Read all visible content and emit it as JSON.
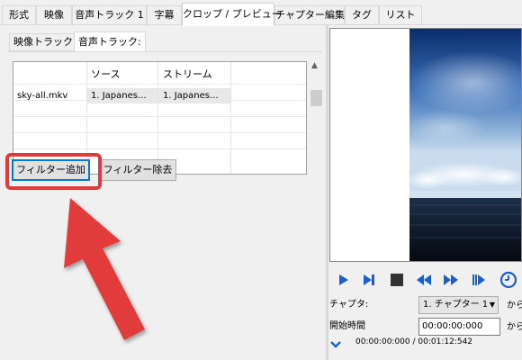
{
  "tabs": [
    "形式",
    "映像",
    "音声トラック 1",
    "字幕",
    "クロップ / プレビュー",
    "チャプター編集",
    "タグ",
    "リスト"
  ],
  "active_tab": "クロップ / プレビュー",
  "filter_tabs": {
    "video": "映像トラック:",
    "audio": "音声トラック:"
  },
  "grid": {
    "headers": [
      "",
      "ソース",
      "ストリーム"
    ],
    "rows": [
      [
        "sky-all.mkv",
        "1. Japanes...",
        "1. Japanes..."
      ]
    ]
  },
  "buttons": {
    "add_filter": "フィルター追加",
    "remove_filter": "フィルター除去"
  },
  "playback": {
    "icons": [
      "play-icon",
      "play-next-icon",
      "stop-icon",
      "rewind-icon",
      "fast-forward-icon",
      "frame-step-icon",
      "clock-icon"
    ],
    "accent": "#1a5fd0"
  },
  "chapter": {
    "label": "チャプタ:",
    "selected": "1. チャプター 1",
    "suffix": "から"
  },
  "start_time": {
    "label": "開始時間",
    "value": "00:00:00:000",
    "suffix": "から"
  },
  "position": {
    "text": "00:00:00:000 / 00:01:12:542"
  },
  "colors": {
    "highlight": "#e23a3a",
    "focus": "#0078d7"
  }
}
